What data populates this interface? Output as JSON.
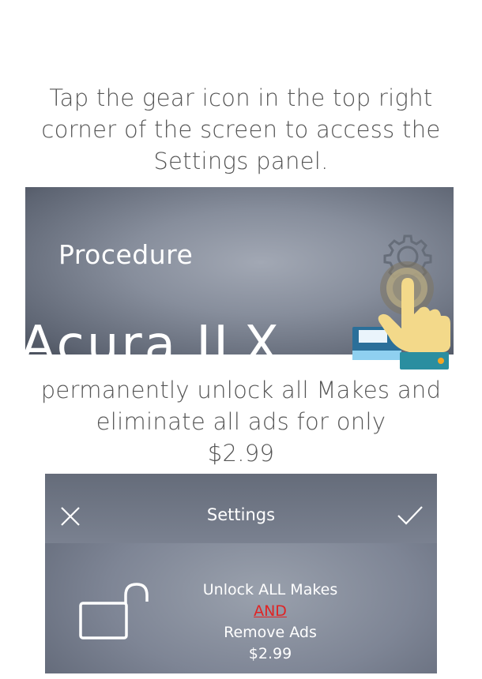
{
  "instructions": {
    "step1": "Tap the gear icon in the top right\ncorner of the screen to access the\nSettings panel.",
    "step2": "permanently unlock all Makes and\neliminate all ads for only\n$2.99"
  },
  "procedure_screen": {
    "heading": "Procedure",
    "car_name": "Acura    ILX",
    "icons": [
      "gear-icon",
      "pointer-hand-icon"
    ]
  },
  "settings_screen": {
    "title": "Settings",
    "close_icon": "close-icon",
    "confirm_icon": "checkmark-icon",
    "lock_icon": "unlocked-padlock-icon",
    "offer": {
      "line1": "Unlock ALL Makes",
      "line2": "AND",
      "line3": "Remove Ads",
      "price": "$2.99"
    }
  },
  "colors": {
    "caption_text": "#555555",
    "and_highlight": "#e02424",
    "hand_skin": "#f3d98a",
    "hand_cuff": "#2a8ea0"
  }
}
